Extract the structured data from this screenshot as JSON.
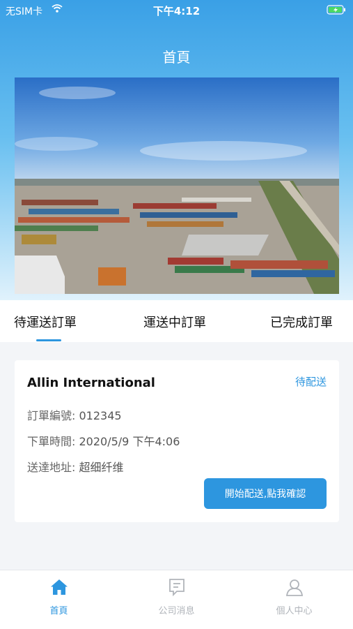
{
  "status_bar": {
    "carrier": "无SIM卡",
    "time": "下午4:12"
  },
  "nav": {
    "title": "首頁"
  },
  "tabs": [
    {
      "label": "待運送訂單"
    },
    {
      "label": "運送中訂單"
    },
    {
      "label": "已完成訂單"
    }
  ],
  "order": {
    "company": "Allin International",
    "status": "待配送",
    "number_label": "訂單編號:",
    "number": "012345",
    "time_label": "下單時間:",
    "time": "2020/5/9 下午4:06",
    "address_label": "送達地址:",
    "address": "超细纤维",
    "action_label": "開始配送,點我確認"
  },
  "bottom_nav": [
    {
      "label": "首頁",
      "icon": "home-icon"
    },
    {
      "label": "公司消息",
      "icon": "message-icon"
    },
    {
      "label": "個人中心",
      "icon": "person-icon"
    }
  ],
  "colors": {
    "accent": "#2d96df",
    "inactive": "#b0b4ba"
  }
}
